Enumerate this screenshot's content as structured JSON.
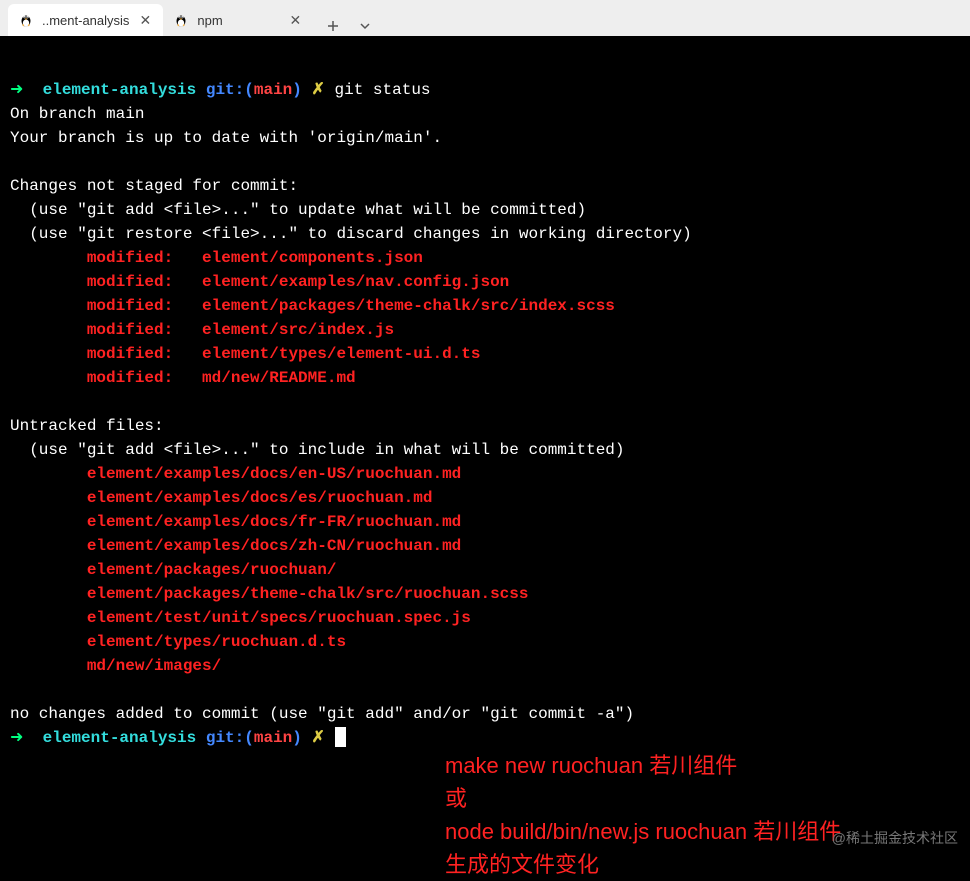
{
  "tabs": {
    "items": [
      {
        "title": "..ment-analysis",
        "active": true
      },
      {
        "title": "npm",
        "active": false
      }
    ]
  },
  "prompt1": {
    "arrow": "➜",
    "dir": "element-analysis",
    "git_label_open": "git:(",
    "git_branch": "main",
    "git_label_close": ")",
    "dirty": "✗",
    "command": "git status"
  },
  "output": {
    "l1": "On branch main",
    "l2": "Your branch is up to date with 'origin/main'.",
    "blank": "",
    "l3": "Changes not staged for commit:",
    "l4": "  (use \"git add <file>...\" to update what will be committed)",
    "l5": "  (use \"git restore <file>...\" to discard changes in working directory)",
    "mod1": "        modified:   element/components.json",
    "mod2": "        modified:   element/examples/nav.config.json",
    "mod3": "        modified:   element/packages/theme-chalk/src/index.scss",
    "mod4": "        modified:   element/src/index.js",
    "mod5": "        modified:   element/types/element-ui.d.ts",
    "mod6": "        modified:   md/new/README.md",
    "l6": "Untracked files:",
    "l7": "  (use \"git add <file>...\" to include in what will be committed)",
    "unt1": "        element/examples/docs/en-US/ruochuan.md",
    "unt2": "        element/examples/docs/es/ruochuan.md",
    "unt3": "        element/examples/docs/fr-FR/ruochuan.md",
    "unt4": "        element/examples/docs/zh-CN/ruochuan.md",
    "unt5": "        element/packages/ruochuan/",
    "unt6": "        element/packages/theme-chalk/src/ruochuan.scss",
    "unt7": "        element/test/unit/specs/ruochuan.spec.js",
    "unt8": "        element/types/ruochuan.d.ts",
    "unt9": "        md/new/images/",
    "l8": "no changes added to commit (use \"git add\" and/or \"git commit -a\")"
  },
  "prompt2": {
    "arrow": "➜",
    "dir": "element-analysis",
    "git_label_open": "git:(",
    "git_branch": "main",
    "git_label_close": ")",
    "dirty": "✗"
  },
  "annotation": {
    "l1": "make new ruochuan 若川组件",
    "l2": "或",
    "l3": "node build/bin/new.js ruochuan 若川组件",
    "l4": "生成的文件变化"
  },
  "watermark": "@稀土掘金技术社区"
}
